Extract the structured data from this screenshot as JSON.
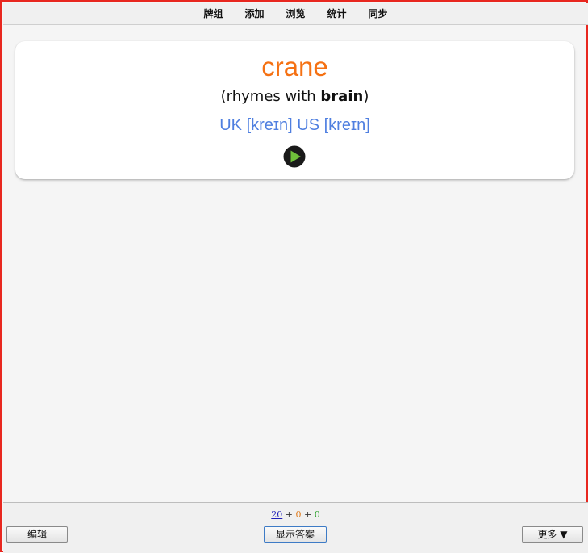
{
  "nav": {
    "items": [
      "牌组",
      "添加",
      "浏览",
      "统计",
      "同步"
    ]
  },
  "card": {
    "word": "crane",
    "rhymes_prefix": "(rhymes with ",
    "rhymes_word": "brain",
    "rhymes_suffix": ")",
    "phonetics": "UK [kreɪn] US [kreɪn]",
    "play_icon": "play-icon"
  },
  "counts": {
    "new": "20",
    "plus1": " + ",
    "learn": "0",
    "plus2": " + ",
    "review": "0"
  },
  "buttons": {
    "edit": "编辑",
    "show_answer": "显示答案",
    "more": "更多 ▼"
  },
  "colors": {
    "border": "#e8271f",
    "word": "#f57113",
    "phonetics": "#4f7fe0",
    "new_count": "#1f1fb8",
    "learn_count": "#e07a1a",
    "review_count": "#2aa02a"
  }
}
